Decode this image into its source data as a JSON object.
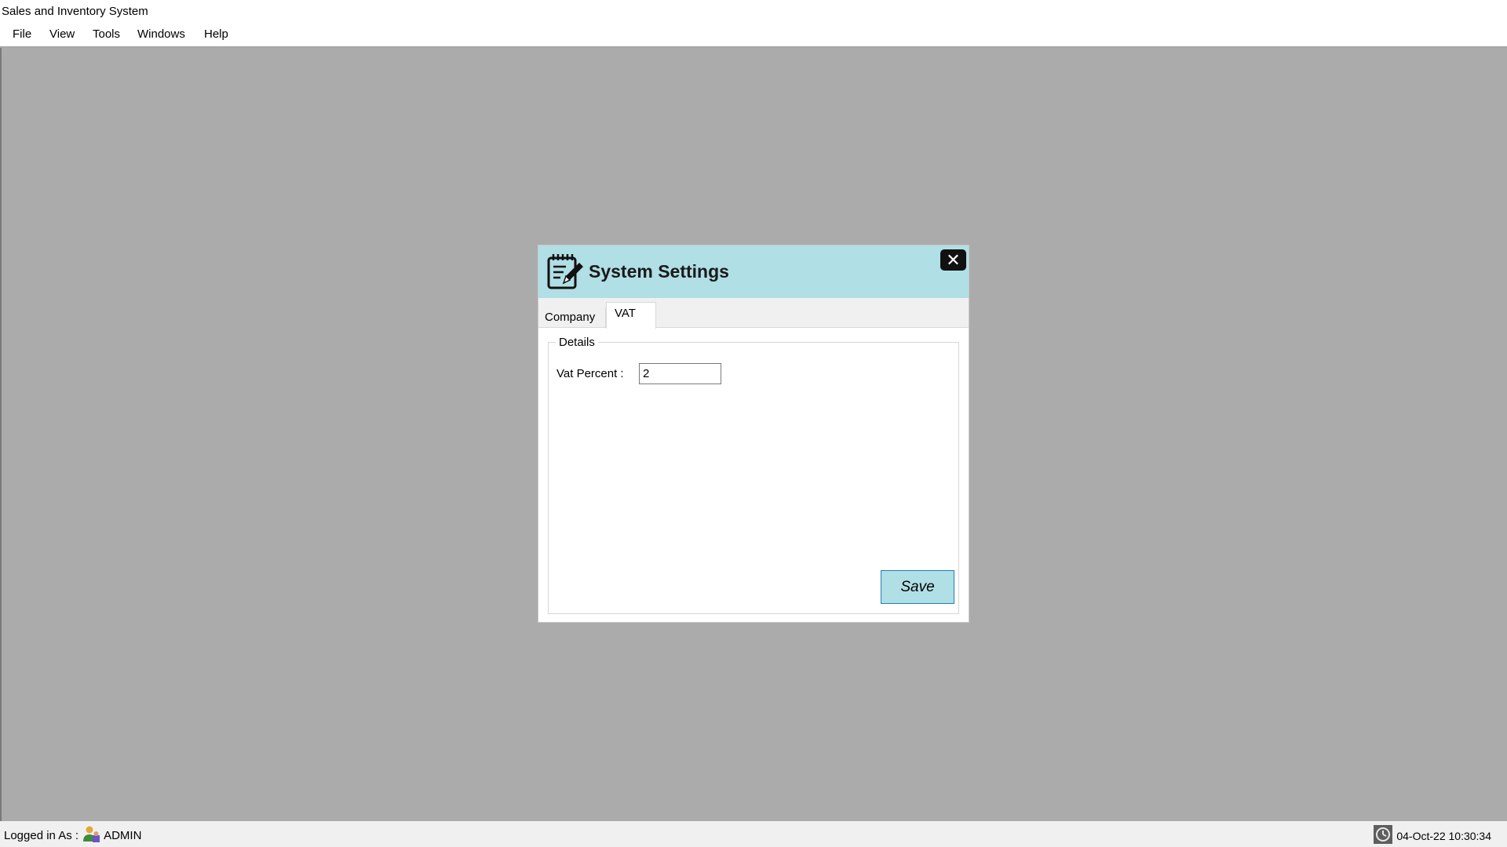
{
  "window": {
    "title": "Sales and Inventory System"
  },
  "menubar": {
    "items": [
      {
        "label": "File"
      },
      {
        "label": "View"
      },
      {
        "label": "Tools"
      },
      {
        "label": "Windows"
      },
      {
        "label": "Help"
      }
    ]
  },
  "dialog": {
    "title": "System Settings",
    "icon": "notepad-edit-icon",
    "close_icon": "close-icon",
    "header_color": "#b0dfe5",
    "tabs": [
      {
        "label": "Company",
        "selected": false
      },
      {
        "label": "VAT",
        "selected": true
      }
    ],
    "group": {
      "legend": "Details",
      "vat_label": "Vat Percent :",
      "vat_value": "2"
    },
    "save_label": "Save"
  },
  "statusbar": {
    "logged_in_label": "Logged in As :",
    "user": "ADMIN",
    "user_icon": "user-icon",
    "datetime": "04-Oct-22 10:30:34",
    "clock_icon": "clock-icon"
  }
}
